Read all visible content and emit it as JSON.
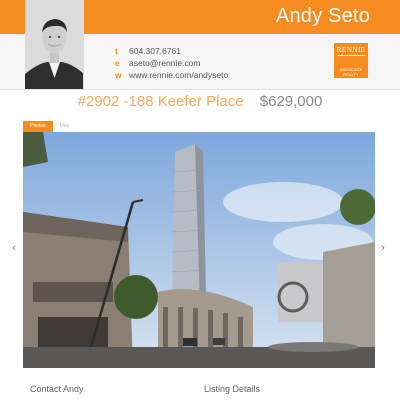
{
  "agent": {
    "name": "Andy Seto",
    "phone_letter": "t",
    "phone": "604.307.6761",
    "email_letter": "e",
    "email": "aseto@rennie.com",
    "web_letter": "w",
    "website": "www.rennie.com/andyseto"
  },
  "brand": {
    "logo_word": "RENNIE",
    "logo_sub_1": "ASSOCIATE",
    "logo_sub_2": "REALTY",
    "accent_color": "#f68b1f"
  },
  "listing": {
    "address": "#2902 -188 Keefer Place",
    "price": "$629,000"
  },
  "tabs": [
    {
      "label": "Photos",
      "active": true
    },
    {
      "label": "Map",
      "active": false
    }
  ],
  "gallery": {
    "prev_icon": "chevron-left-icon",
    "next_icon": "chevron-right-icon"
  },
  "sections": {
    "contact_title": "Contact Andy",
    "details_title": "Listing Details"
  }
}
